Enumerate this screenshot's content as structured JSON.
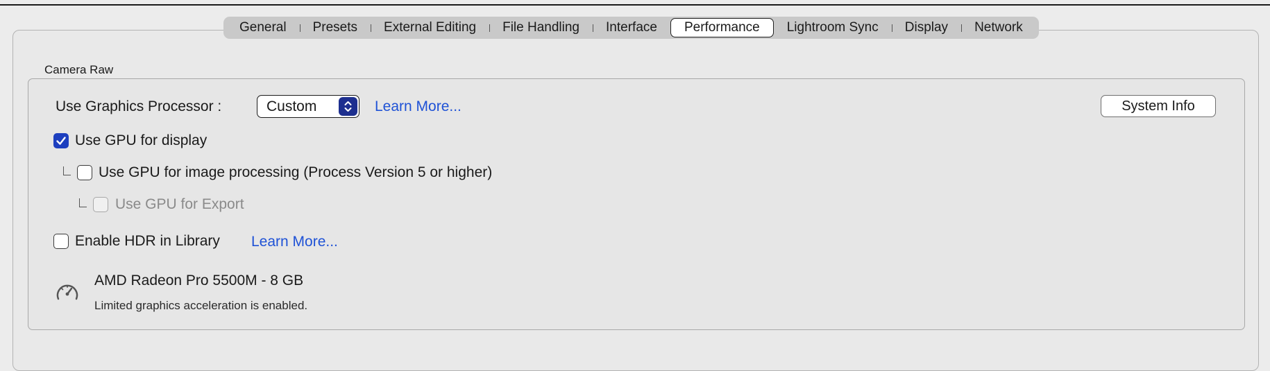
{
  "tabs": [
    {
      "label": "General",
      "selected": false
    },
    {
      "label": "Presets",
      "selected": false
    },
    {
      "label": "External Editing",
      "selected": false
    },
    {
      "label": "File Handling",
      "selected": false
    },
    {
      "label": "Interface",
      "selected": false
    },
    {
      "label": "Performance",
      "selected": true
    },
    {
      "label": "Lightroom Sync",
      "selected": false
    },
    {
      "label": "Display",
      "selected": false
    },
    {
      "label": "Network",
      "selected": false
    }
  ],
  "camera_raw": {
    "group_title": "Camera Raw",
    "graphics_processor": {
      "label": "Use Graphics Processor :",
      "selected_value": "Custom",
      "learn_more": "Learn More..."
    },
    "system_info_button": "System Info",
    "use_gpu_display": {
      "label": "Use GPU for display",
      "checked": true
    },
    "use_gpu_image_processing": {
      "label": "Use GPU for image processing (Process Version 5 or higher)",
      "checked": false
    },
    "use_gpu_export": {
      "label": "Use GPU for Export",
      "checked": false,
      "enabled": false
    },
    "enable_hdr": {
      "label": "Enable HDR in Library",
      "checked": false,
      "learn_more": "Learn More..."
    },
    "gpu_info": {
      "icon": "gauge-icon",
      "name": "AMD Radeon Pro 5500M - 8 GB",
      "status": "Limited graphics acceleration is enabled."
    }
  },
  "colors": {
    "accent": "#1d3fbf",
    "link": "#1f52d6",
    "stepper": "#1d2f8f"
  }
}
